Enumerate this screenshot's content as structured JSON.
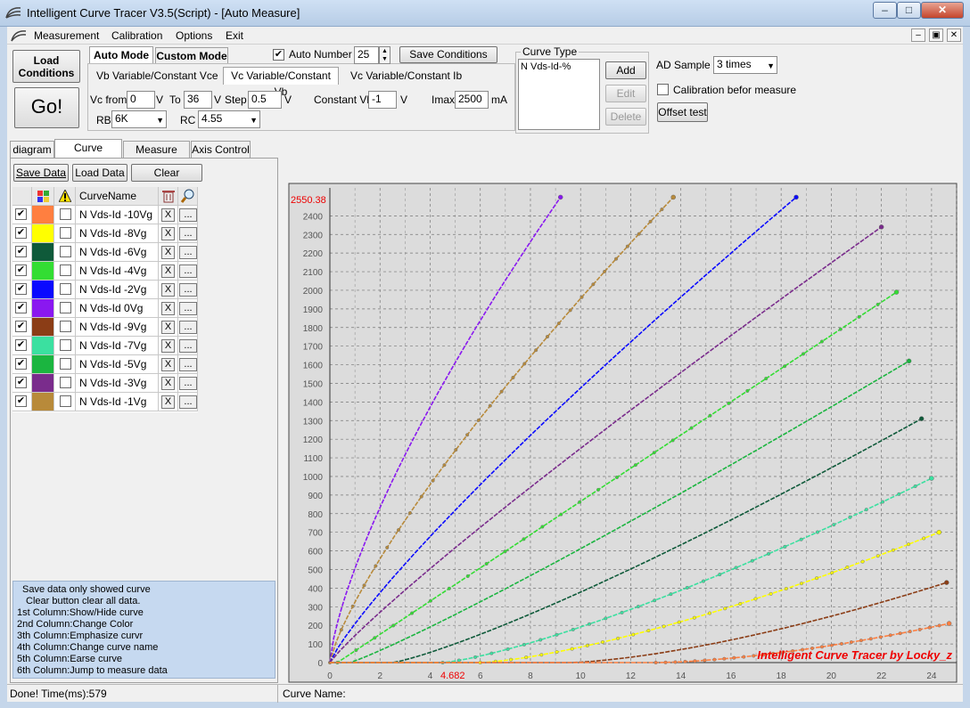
{
  "window": {
    "title": "Intelligent Curve Tracer V3.5(Script) - [Auto Measure]",
    "minimize": "–",
    "maximize": "□",
    "close": "✕"
  },
  "menu": [
    "Measurement",
    "Calibration",
    "Options",
    "Exit"
  ],
  "mdi_controls": [
    "–",
    "▣",
    "✕"
  ],
  "toolbar": {
    "load_conditions": "Load\nConditions",
    "go": "Go!",
    "mode_tabs": [
      "Auto Mode",
      "Custom Mode"
    ],
    "auto_number_label": "Auto Number",
    "auto_number_checked": true,
    "auto_number_value": "25",
    "save_conditions": "Save Conditions",
    "sub_tabs": [
      "Vb Variable/Constant Vce",
      "Vc Variable/Constant Vb",
      "Vc Variable/Constant Ib"
    ],
    "vc_from_label": "Vc from",
    "vc_from": "0",
    "v1": "V",
    "to_label": "To",
    "vc_to": "36",
    "v2": "V",
    "step_label": "Step",
    "step": "0.5",
    "v3": "V",
    "constant_vb_label": "Constant Vb",
    "constant_vb": "-1",
    "v4": "V",
    "imax_label": "Imax",
    "imax": "2500",
    "ma": "mA",
    "rb_label": "RB",
    "rb": "6K",
    "rc_label": "RC",
    "rc": "4.55"
  },
  "curve_type": {
    "title": "Curve Type",
    "items": [
      "N Vds-Id-%"
    ],
    "add": "Add",
    "edit": "Edit",
    "delete": "Delete"
  },
  "ad": {
    "label": "AD Sample",
    "value": "3 times",
    "calibration_label": "Calibration befor measure",
    "calibration_checked": false,
    "offset_test": "Offset test"
  },
  "left_tabs": [
    "diagram",
    "Curve Control",
    "Measure Data",
    "Axis Control"
  ],
  "left_buttons": {
    "save": "Save Data",
    "load": "Load Data",
    "clear": "Clear"
  },
  "table": {
    "header_name": "CurveName",
    "x_label": "X",
    "more_label": "...",
    "rows": [
      {
        "name": "N Vds-Id -10Vg",
        "color": "#ff7f40",
        "checked": true
      },
      {
        "name": "N Vds-Id -8Vg",
        "color": "#ffff00",
        "checked": true
      },
      {
        "name": "N Vds-Id -6Vg",
        "color": "#0f5a3a",
        "checked": true
      },
      {
        "name": "N Vds-Id -4Vg",
        "color": "#33dd33",
        "checked": true
      },
      {
        "name": "N Vds-Id -2Vg",
        "color": "#0a0aff",
        "checked": true
      },
      {
        "name": "N Vds-Id 0Vg",
        "color": "#8a18f0",
        "checked": true
      },
      {
        "name": "N Vds-Id -9Vg",
        "color": "#8b3d16",
        "checked": true
      },
      {
        "name": "N Vds-Id -7Vg",
        "color": "#3be0a0",
        "checked": true
      },
      {
        "name": "N Vds-Id -5Vg",
        "color": "#1bb540",
        "checked": true
      },
      {
        "name": "N Vds-Id -3Vg",
        "color": "#7a2c8c",
        "checked": true
      },
      {
        "name": "N Vds-Id -1Vg",
        "color": "#b88a3a",
        "checked": true
      }
    ]
  },
  "help_lines": [
    "Save data only showed curve",
    "Clear button clear all data.",
    "1st Column:Show/Hide curve",
    "2nd Column:Change Color",
    "3th Column:Emphasize curvr",
    "4th Column:Change curve name",
    "5th Column:Earse curve",
    "6th Column:Jump to measure data"
  ],
  "status": {
    "left": "Done!  Time(ms):579",
    "right": "Curve Name:"
  },
  "chart_data": {
    "type": "line",
    "title": "",
    "xlabel": "",
    "ylabel": "",
    "xlim": [
      0,
      25
    ],
    "ylim": [
      0,
      2550
    ],
    "x_ticks": [
      0,
      2,
      4,
      6,
      8,
      10,
      12,
      14,
      16,
      18,
      20,
      22,
      24
    ],
    "y_ticks": [
      0,
      100,
      200,
      300,
      400,
      500,
      600,
      700,
      800,
      900,
      1000,
      1100,
      1200,
      1300,
      1400,
      1500,
      1600,
      1700,
      1800,
      1900,
      2000,
      2100,
      2200,
      2300,
      2400
    ],
    "grid": true,
    "cursor_y_label": "2550.38",
    "cursor_x_label": "4.682",
    "watermark": "Intelligent Curve Tracer by Locky_z",
    "background": "#dcdcdc",
    "series": [
      {
        "color": "#8a18f0",
        "x0": 0,
        "x_end": 9.2,
        "y_end": 2500,
        "p": 0.72,
        "markers": false
      },
      {
        "color": "#b88a3a",
        "x0": 0,
        "x_end": 13.7,
        "y_end": 2500,
        "p": 0.78,
        "markers": true
      },
      {
        "color": "#0a0aff",
        "x0": 0,
        "x_end": 18.6,
        "y_end": 2500,
        "p": 0.85,
        "markers": false
      },
      {
        "color": "#7a2c8c",
        "x0": 0,
        "x_end": 22.0,
        "y_end": 2340,
        "p": 0.9,
        "markers": false
      },
      {
        "color": "#33dd33",
        "x0": 0.3,
        "x_end": 22.6,
        "y_end": 1990,
        "p": 1.0,
        "markers": true
      },
      {
        "color": "#1bb540",
        "x0": 0.8,
        "x_end": 23.1,
        "y_end": 1620,
        "p": 1.1,
        "markers": false
      },
      {
        "color": "#0f5a3a",
        "x0": 2.5,
        "x_end": 23.6,
        "y_end": 1310,
        "p": 1.2,
        "markers": false
      },
      {
        "color": "#3be0a0",
        "x0": 4.5,
        "x_end": 24.0,
        "y_end": 990,
        "p": 1.3,
        "markers": true
      },
      {
        "color": "#ffff00",
        "x0": 6.0,
        "x_end": 24.3,
        "y_end": 700,
        "p": 1.4,
        "markers": true
      },
      {
        "color": "#8b3d16",
        "x0": 9.5,
        "x_end": 24.6,
        "y_end": 430,
        "p": 1.5,
        "markers": false
      },
      {
        "color": "#ff7f40",
        "x0": 13.0,
        "x_end": 24.7,
        "y_end": 210,
        "p": 1.6,
        "markers": true
      }
    ]
  }
}
